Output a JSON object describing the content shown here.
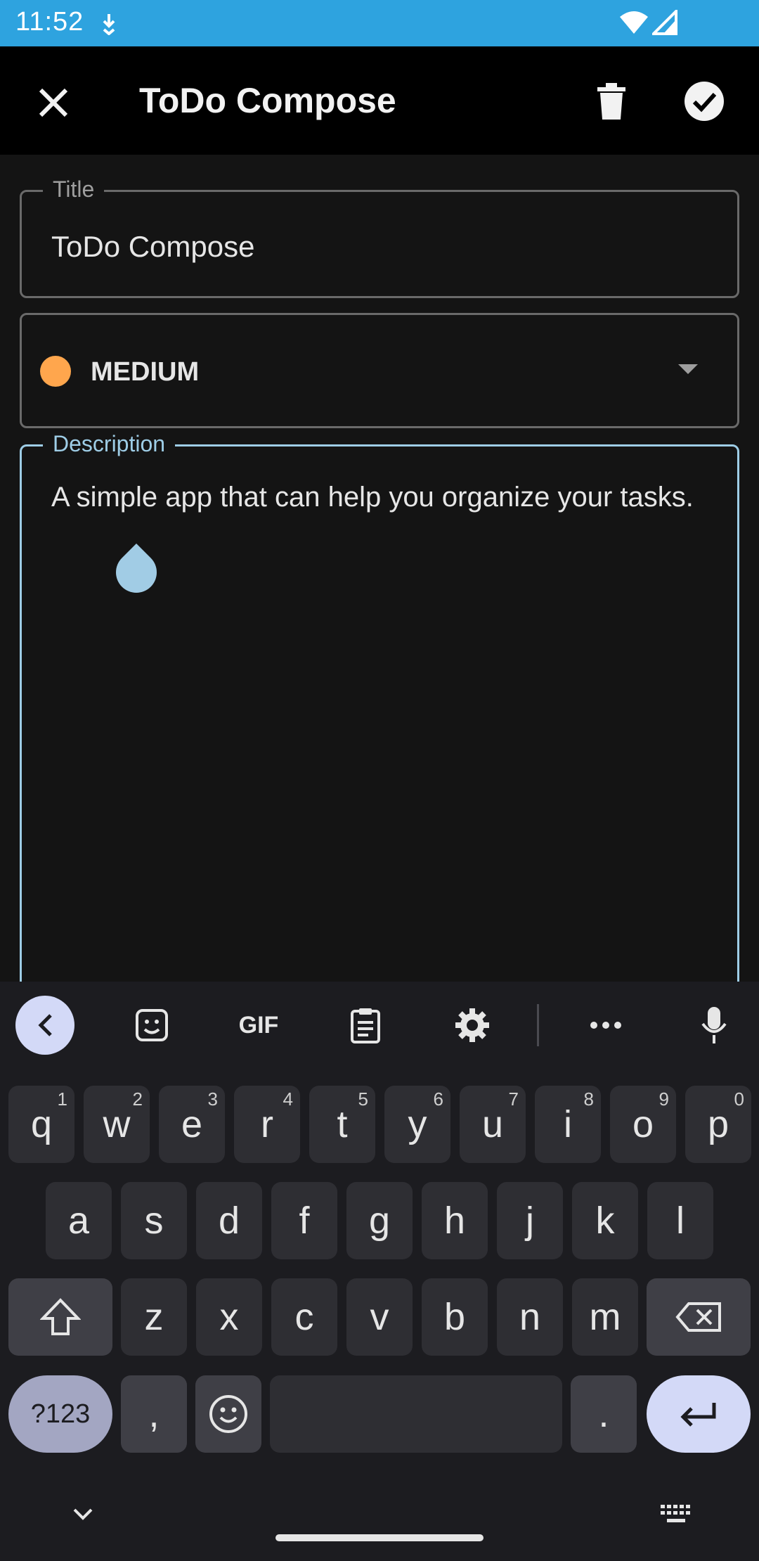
{
  "status_bar": {
    "time": "11:52"
  },
  "app_bar": {
    "title": "ToDo Compose"
  },
  "title_field": {
    "label": "Title",
    "value": "ToDo Compose"
  },
  "priority_field": {
    "value": "MEDIUM",
    "color": "#ffa64d"
  },
  "description_field": {
    "label": "Description",
    "value": "A simple app that can help you organize your tasks."
  },
  "keyboard": {
    "row1": [
      {
        "key": "q",
        "hint": "1"
      },
      {
        "key": "w",
        "hint": "2"
      },
      {
        "key": "e",
        "hint": "3"
      },
      {
        "key": "r",
        "hint": "4"
      },
      {
        "key": "t",
        "hint": "5"
      },
      {
        "key": "y",
        "hint": "6"
      },
      {
        "key": "u",
        "hint": "7"
      },
      {
        "key": "i",
        "hint": "8"
      },
      {
        "key": "o",
        "hint": "9"
      },
      {
        "key": "p",
        "hint": "0"
      }
    ],
    "row2": [
      "a",
      "s",
      "d",
      "f",
      "g",
      "h",
      "j",
      "k",
      "l"
    ],
    "row3": [
      "z",
      "x",
      "c",
      "v",
      "b",
      "n",
      "m"
    ],
    "symbols_label": "?123",
    "comma": ",",
    "period": ".",
    "gif_label": "GIF"
  },
  "colors": {
    "accent": "#2ea3df",
    "focus": "#9ecde6"
  }
}
